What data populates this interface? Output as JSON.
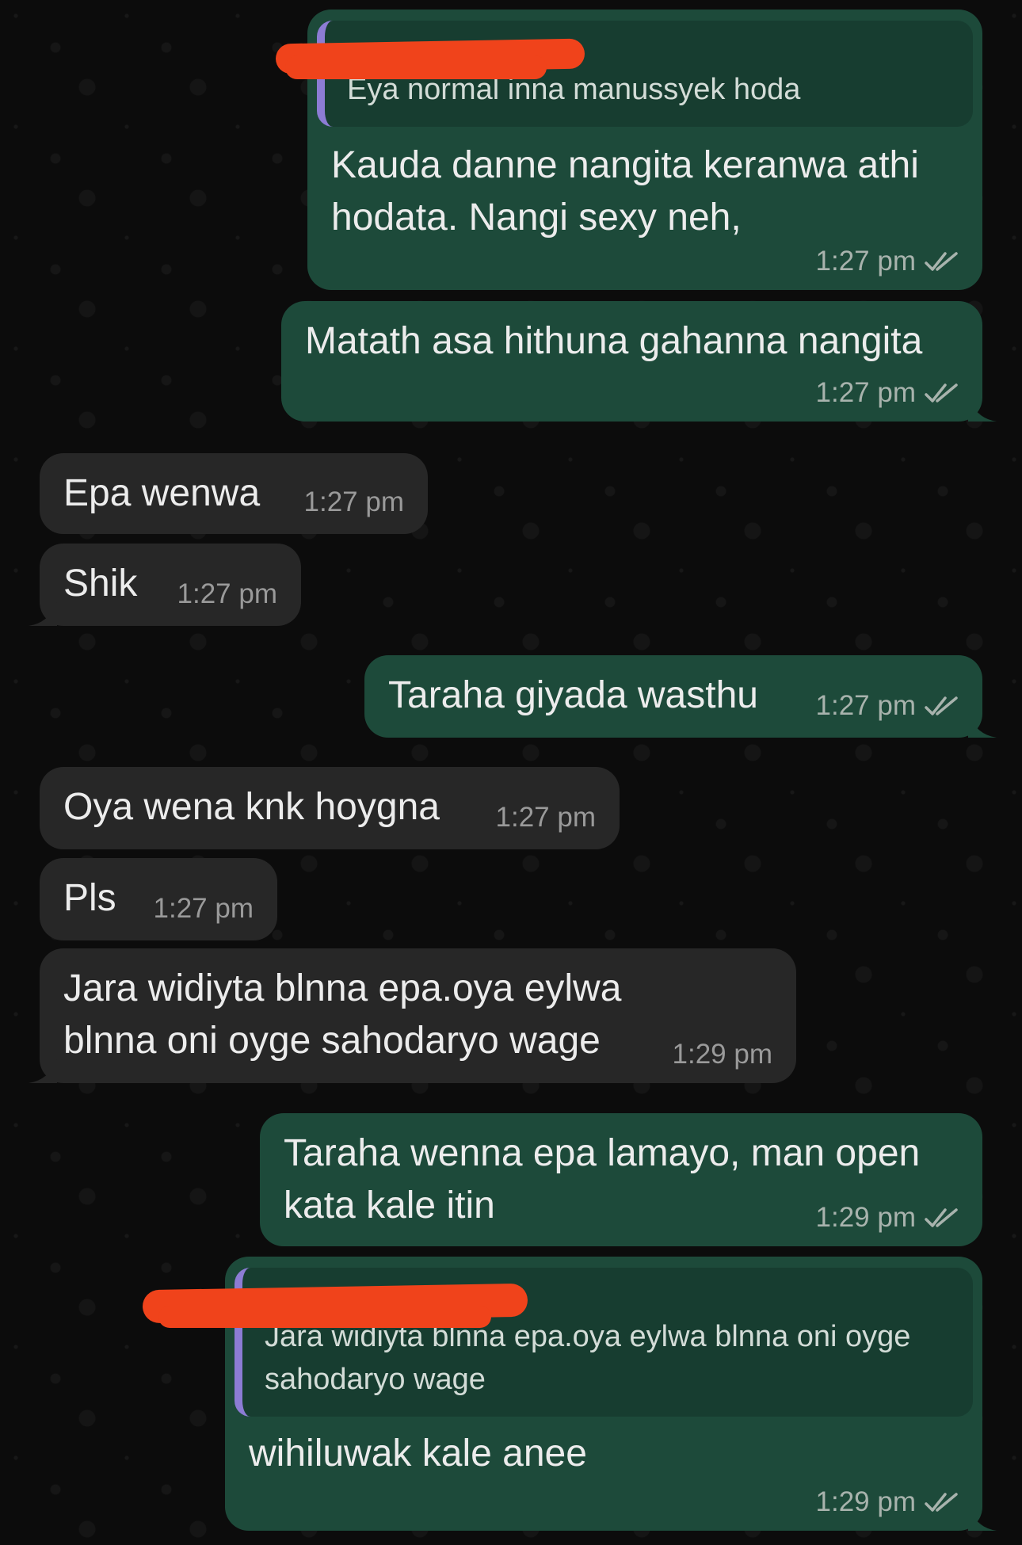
{
  "colors": {
    "outgoing_bubble": "#1d4a3a",
    "incoming_bubble": "#272727",
    "quote_bar": "#8c7cd4",
    "redaction": "#f0431b",
    "background": "#0b0b0b"
  },
  "messages": [
    {
      "direction": "outgoing",
      "quote": "Eya normal inna manussyek hoda",
      "text": "Kauda danne nangita keranwa athi hodata. Nangi sexy neh,",
      "time": "1:27 pm",
      "status": "read-double-tick-icon"
    },
    {
      "direction": "outgoing",
      "text": "Matath asa hithuna gahanna nangita",
      "time": "1:27 pm",
      "status": "read-double-tick-icon"
    },
    {
      "direction": "incoming",
      "text": "Epa wenwa",
      "time": "1:27 pm"
    },
    {
      "direction": "incoming",
      "text": "Shik",
      "time": "1:27 pm"
    },
    {
      "direction": "outgoing",
      "text": "Taraha giyada wasthu",
      "time": "1:27 pm",
      "status": "read-double-tick-icon"
    },
    {
      "direction": "incoming",
      "text": "Oya wena knk hoygna",
      "time": "1:27 pm"
    },
    {
      "direction": "incoming",
      "text": "Pls",
      "time": "1:27 pm"
    },
    {
      "direction": "incoming",
      "text": "Jara widiyta blnna epa.oya eylwa blnna oni oyge sahodaryo wage",
      "time": "1:29 pm"
    },
    {
      "direction": "outgoing",
      "text": "Taraha wenna epa lamayo, man open kata kale itin",
      "time": "1:29 pm",
      "status": "read-double-tick-icon"
    },
    {
      "direction": "outgoing",
      "quote": "Jara widiyta blnna epa.oya eylwa blnna oni oyge sahodaryo wage",
      "text": "wihiluwak kale anee",
      "time": "1:29 pm",
      "status": "read-double-tick-icon"
    }
  ]
}
